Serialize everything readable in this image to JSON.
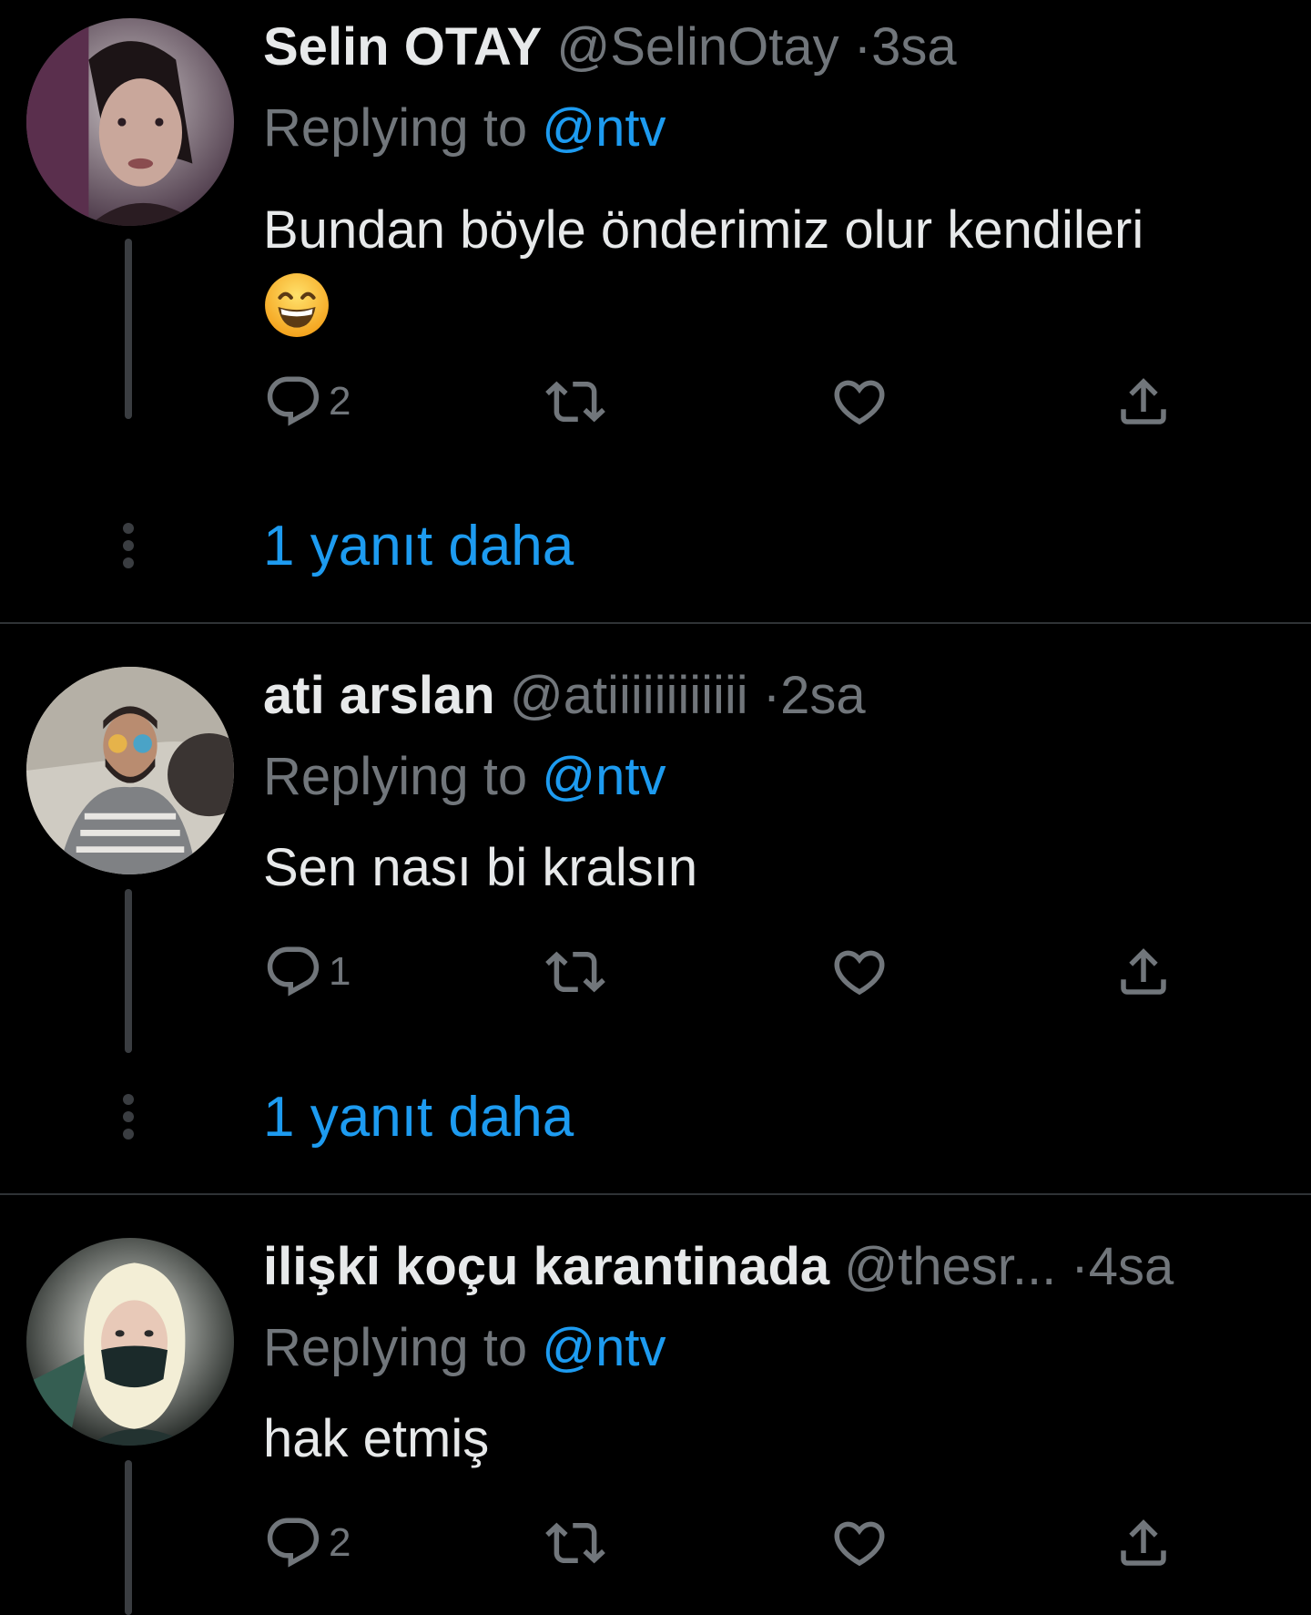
{
  "tweets": [
    {
      "name": "Selin OTAY",
      "handle": "@SelinOtay",
      "separator": "·",
      "time": "3sa",
      "replying_prefix": "Replying to",
      "replying_to": "@ntv",
      "text": "Bundan böyle önderimiz olur kendileri",
      "emoji": "grinning-face-with-smiling-eyes",
      "reply_count": "2",
      "more_replies": "1 yanıt daha"
    },
    {
      "name": "ati arslan",
      "handle": "@atiiiiiiiiiiii",
      "separator": "·",
      "time": "2sa",
      "replying_prefix": "Replying to",
      "replying_to": "@ntv",
      "text": "Sen nası bi kralsın",
      "reply_count": "1",
      "more_replies": "1 yanıt daha"
    },
    {
      "name": "ilişki koçu karantinada",
      "handle": "@thesr...",
      "separator": "·",
      "time": "4sa",
      "replying_prefix": "Replying to",
      "replying_to": "@ntv",
      "text": "hak etmiş",
      "reply_count": "2"
    }
  ],
  "icons": {
    "reply": "reply-icon",
    "retweet": "retweet-icon",
    "like": "heart-icon",
    "share": "share-icon"
  },
  "colors": {
    "background": "#000000",
    "text": "#e7e9ea",
    "secondary": "#71767b",
    "accent": "#1d9bf0",
    "divider": "#2f3336"
  }
}
